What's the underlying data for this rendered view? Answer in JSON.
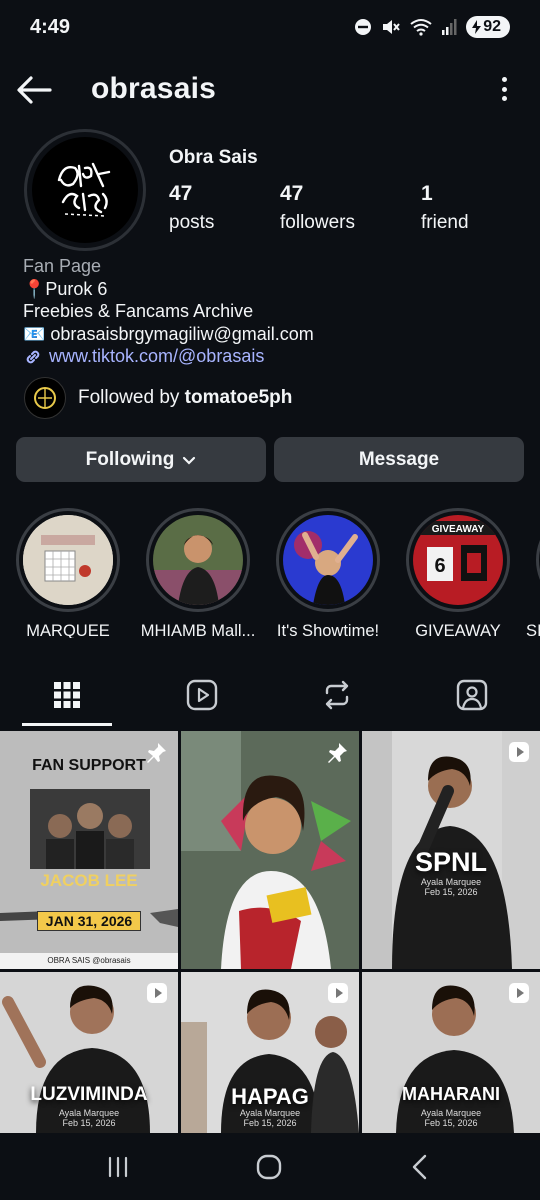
{
  "status_bar": {
    "time": "4:49",
    "battery": "92"
  },
  "header": {
    "username": "obrasais"
  },
  "profile": {
    "display_name": "Obra Sais",
    "stats": [
      {
        "value": "47",
        "label": "posts"
      },
      {
        "value": "47",
        "label": "followers"
      },
      {
        "value": "1",
        "label": "friend"
      }
    ],
    "bio": {
      "category": "Fan Page",
      "line1": "📍Purok 6",
      "line2": "Freebies & Fancams Archive",
      "line3": "📧 obrasaisbrgymagiliw@gmail.com",
      "link": "www.tiktok.com/@obrasais"
    },
    "followed_by_prefix": "Followed by ",
    "followed_by_name": "tomatoe5ph"
  },
  "actions": {
    "following_label": "Following",
    "message_label": "Message"
  },
  "highlights": [
    {
      "label": "MARQUEE"
    },
    {
      "label": "MHIAMB Mall..."
    },
    {
      "label": "It's Showtime!"
    },
    {
      "label": "GIVEAWAY"
    },
    {
      "label": "SI"
    }
  ],
  "grid": [
    {
      "kind": "poster",
      "pinned": true,
      "header": "FAN SUPPORT",
      "name": "JACOB LEE",
      "date": "JAN 31, 2026",
      "footer": "OBRA SAIS   @obrasais"
    },
    {
      "kind": "photo",
      "pinned": true
    },
    {
      "kind": "reel",
      "title": "SPNL",
      "venue": "Ayala Marquee",
      "date": "Feb 15, 2026"
    },
    {
      "kind": "reel",
      "title": "LUZVIMINDA",
      "venue": "Ayala Marquee",
      "date": "Feb 15, 2026"
    },
    {
      "kind": "reel",
      "title": "HAPAG",
      "venue": "Ayala Marquee",
      "date": "Feb 15, 2026"
    },
    {
      "kind": "reel",
      "title": "MAHARANI",
      "venue": "Ayala Marquee",
      "date": "Feb 15, 2026"
    }
  ],
  "colors": {
    "background": "#0c0f14",
    "button": "#363a40",
    "link": "#a8b4ff",
    "muted": "#a8adb4"
  }
}
